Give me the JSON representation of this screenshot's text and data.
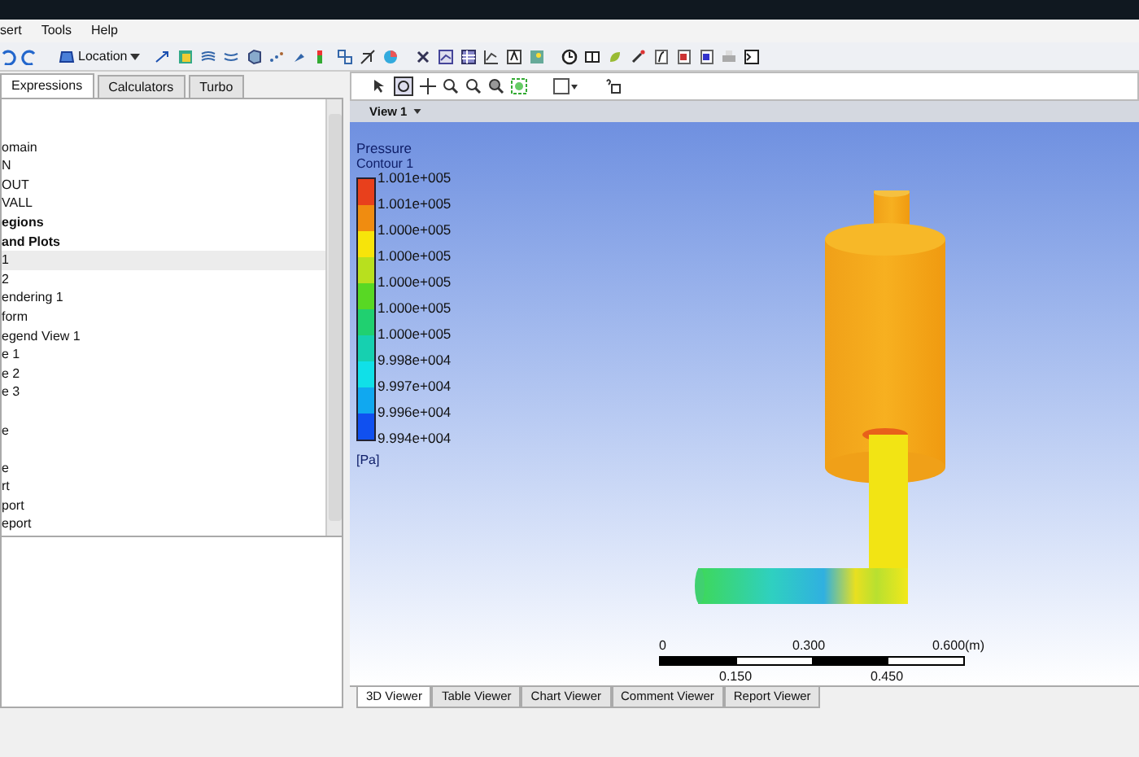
{
  "menu": [
    "sert",
    "Tools",
    "Help"
  ],
  "toolbar": {
    "location_label": "Location"
  },
  "left_tabs": [
    {
      "label": "Expressions",
      "selected": true
    },
    {
      "label": "Calculators",
      "selected": false
    },
    {
      "label": "Turbo",
      "selected": false
    }
  ],
  "tree": [
    {
      "label": "omain",
      "kind": "item",
      "selected": false,
      "gap_before": true
    },
    {
      "label": "N",
      "kind": "item",
      "selected": false,
      "gap_before": false
    },
    {
      "label": "OUT",
      "kind": "item",
      "selected": false,
      "gap_before": false
    },
    {
      "label": "VALL",
      "kind": "item",
      "selected": false,
      "gap_before": false
    },
    {
      "label": "egions",
      "kind": "header",
      "selected": false,
      "gap_before": false
    },
    {
      "label": "and Plots",
      "kind": "header",
      "selected": false,
      "gap_before": false
    },
    {
      "label": "1",
      "kind": "item",
      "selected": true,
      "gap_before": false
    },
    {
      "label": "2",
      "kind": "item",
      "selected": false,
      "gap_before": false
    },
    {
      "label": "endering 1",
      "kind": "item",
      "selected": false,
      "gap_before": false
    },
    {
      "label": "form",
      "kind": "item",
      "selected": false,
      "gap_before": false
    },
    {
      "label": "egend View 1",
      "kind": "item",
      "selected": false,
      "gap_before": false
    },
    {
      "label": "e 1",
      "kind": "item",
      "selected": false,
      "gap_before": false
    },
    {
      "label": "e 2",
      "kind": "item",
      "selected": false,
      "gap_before": false
    },
    {
      "label": "e 3",
      "kind": "item",
      "selected": false,
      "gap_before": false
    },
    {
      "label": "e",
      "kind": "item",
      "selected": false,
      "gap_before": true
    },
    {
      "label": "e",
      "kind": "item",
      "selected": false,
      "gap_before": true
    },
    {
      "label": "rt",
      "kind": "item",
      "selected": false,
      "gap_before": false
    },
    {
      "label": "port",
      "kind": "item",
      "selected": false,
      "gap_before": false
    },
    {
      "label": "eport",
      "kind": "item",
      "selected": false,
      "gap_before": false
    }
  ],
  "viewer": {
    "view_label": "View 1",
    "legend": {
      "title": "Pressure",
      "subtitle": "Contour 1",
      "unit": "[Pa]",
      "bands": [
        {
          "color": "#e8401c"
        },
        {
          "color": "#f08c10"
        },
        {
          "color": "#f7e40a"
        },
        {
          "color": "#b8e01e"
        },
        {
          "color": "#58d824"
        },
        {
          "color": "#20d070"
        },
        {
          "color": "#16d0b0"
        },
        {
          "color": "#10e0e8"
        },
        {
          "color": "#10a8f0"
        },
        {
          "color": "#1050f0"
        }
      ],
      "labels": [
        "1.001e+005",
        "1.001e+005",
        "1.000e+005",
        "1.000e+005",
        "1.000e+005",
        "1.000e+005",
        "1.000e+005",
        "9.998e+004",
        "9.997e+004",
        "9.996e+004",
        "9.994e+004"
      ]
    },
    "scale": {
      "top_labels": [
        "0",
        "0.300",
        "0.600"
      ],
      "unit": "(m)",
      "bottom_labels": [
        "0.150",
        "0.450"
      ]
    }
  },
  "bottom_tabs": [
    {
      "label": "3D Viewer",
      "selected": true
    },
    {
      "label": "Table Viewer",
      "selected": false
    },
    {
      "label": "Chart Viewer",
      "selected": false
    },
    {
      "label": "Comment Viewer",
      "selected": false
    },
    {
      "label": "Report Viewer",
      "selected": false
    }
  ]
}
